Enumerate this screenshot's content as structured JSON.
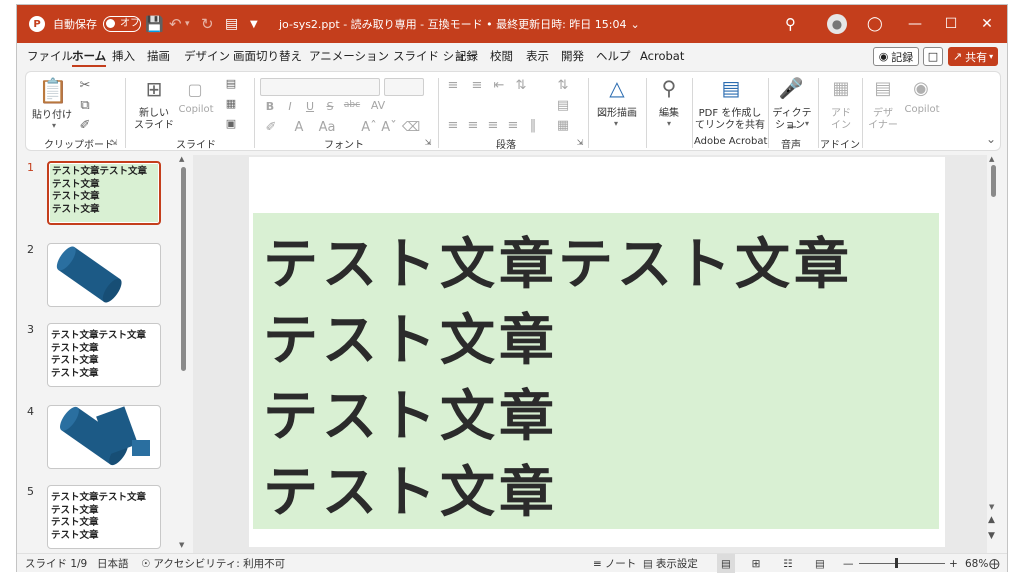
{
  "titlebar": {
    "autosave_label": "自動保存",
    "autosave_state": "オフ",
    "document_title": "jo-sys2.ppt - 読み取り専用 - 互換モード • 最終更新日時: 昨日 15:04",
    "accent": "#c43e1c"
  },
  "menu": {
    "tabs": [
      "ファイル",
      "ホーム",
      "挿入",
      "描画",
      "デザイン",
      "画面切り替え",
      "アニメーション",
      "スライド ショー",
      "記録",
      "校閲",
      "表示",
      "開発",
      "ヘルプ",
      "Acrobat"
    ],
    "active_tab": "ホーム",
    "record_button": "記録",
    "share_button": "共有"
  },
  "ribbon": {
    "clipboard": {
      "paste": "貼り付け",
      "group": "クリップボード"
    },
    "slides": {
      "new_slide_1": "新しい",
      "new_slide_2": "スライド",
      "copilot": "Copilot",
      "group": "スライド"
    },
    "font": {
      "group": "フォント",
      "bold": "B",
      "italic": "I",
      "underline": "U",
      "strike": "S",
      "abc": "abc"
    },
    "paragraph": {
      "group": "段落"
    },
    "drawing": {
      "label": "図形描画"
    },
    "editing": {
      "label": "編集"
    },
    "acrobat": {
      "line1": "PDF を作成し",
      "line2": "てリンクを共有",
      "group": "Adobe Acrobat"
    },
    "voice": {
      "line1": "ディクテー",
      "line2": "ション",
      "group": "音声"
    },
    "addins": {
      "designer_1": "デザ",
      "designer_2": "イナー",
      "copilot": "Copilot",
      "addin_1": "アド",
      "addin_2": "イン",
      "group": "アドイン"
    }
  },
  "thumbnails": [
    {
      "num": "1",
      "type": "text",
      "lines": [
        "テスト文章テスト文章",
        "テスト文章",
        "テスト文章",
        "テスト文章"
      ],
      "selected": true,
      "bg": "#d9f0d3"
    },
    {
      "num": "2",
      "type": "cylinder",
      "selected": false
    },
    {
      "num": "3",
      "type": "text",
      "lines": [
        "テスト文章テスト文章",
        "テスト文章",
        "テスト文章",
        "テスト文章"
      ],
      "selected": false
    },
    {
      "num": "4",
      "type": "cylinder",
      "selected": false
    },
    {
      "num": "5",
      "type": "text",
      "lines": [
        "テスト文章テスト文章",
        "テスト文章",
        "テスト文章",
        "テスト文章"
      ],
      "selected": false
    }
  ],
  "slide": {
    "lines": [
      "テスト文章テスト文章",
      "テスト文章",
      "テスト文章",
      "テスト文章"
    ],
    "box_color": "#d9f0d3"
  },
  "status": {
    "slide_counter": "スライド 1/9",
    "language": "日本語",
    "accessibility": "アクセシビリティ: 利用不可",
    "notes": "ノート",
    "display_settings": "表示設定",
    "zoom": "68%"
  }
}
